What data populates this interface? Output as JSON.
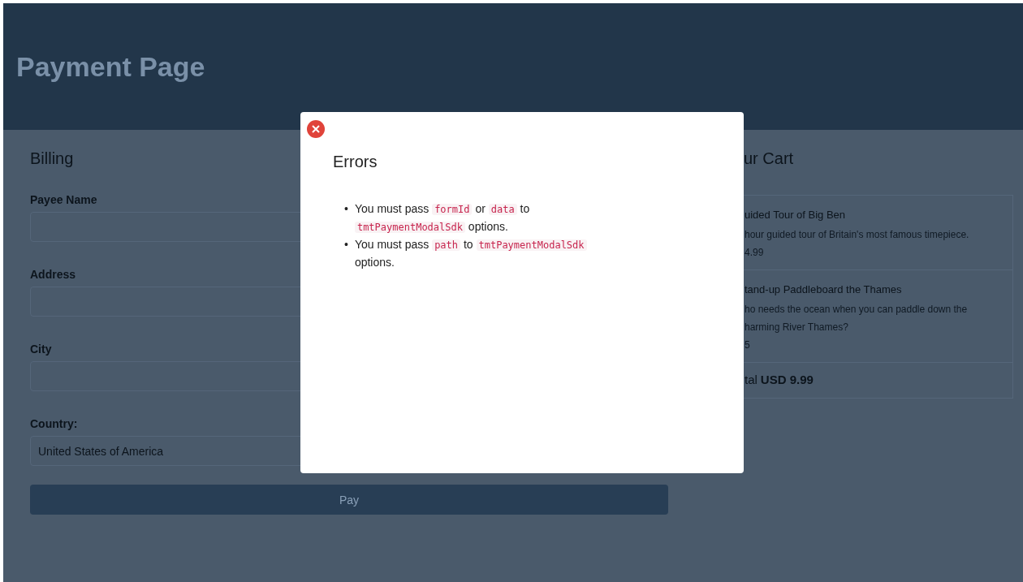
{
  "header": {
    "title": "Payment Page"
  },
  "billing": {
    "heading": "Billing",
    "fields": [
      {
        "label": "Payee Name"
      },
      {
        "label": "Address"
      },
      {
        "label": "City"
      },
      {
        "label": "Country:",
        "value": "United States of America"
      }
    ],
    "pay_button": "Pay"
  },
  "cart": {
    "heading": "ur Cart",
    "items": [
      {
        "title": "uided Tour of Big Ben",
        "description": "hour guided tour of Britain's most famous timepiece.",
        "price": "4.99"
      },
      {
        "title": "tand-up Paddleboard the Thames",
        "description": "ho needs the ocean when you can paddle down the harming River Thames?",
        "price": "5"
      }
    ],
    "total_label": "tal",
    "total_value": "USD 9.99"
  },
  "modal": {
    "title": "Errors",
    "errors": [
      {
        "marker": "•",
        "parts": [
          {
            "kind": "text",
            "text": "You must pass"
          },
          {
            "kind": "code",
            "text": "formId"
          },
          {
            "kind": "text",
            "text": "or"
          },
          {
            "kind": "code",
            "text": "data"
          },
          {
            "kind": "text",
            "text": "to"
          },
          {
            "kind": "code",
            "text": "tmtPaymentModalSdk"
          },
          {
            "kind": "text",
            "text": "options."
          }
        ]
      },
      {
        "marker": "•",
        "parts": [
          {
            "kind": "text",
            "text": "You must pass"
          },
          {
            "kind": "code",
            "text": "path"
          },
          {
            "kind": "text",
            "text": "to"
          },
          {
            "kind": "code",
            "text": "tmtPaymentModalSdk"
          },
          {
            "kind": "text",
            "text": "options."
          }
        ]
      }
    ]
  }
}
